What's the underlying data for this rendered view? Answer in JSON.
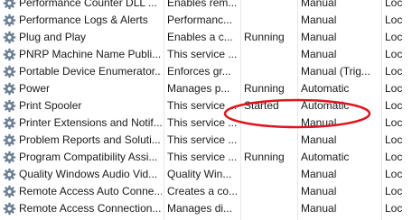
{
  "services": [
    {
      "name": "Performance Counter DLL ...",
      "description": "Enables rem...",
      "status": "",
      "startup_type": "Manual",
      "log_on_as": "Loc"
    },
    {
      "name": "Performance Logs & Alerts",
      "description": "Performanc...",
      "status": "",
      "startup_type": "Manual",
      "log_on_as": "Loc"
    },
    {
      "name": "Plug and Play",
      "description": "Enables a c...",
      "status": "Running",
      "startup_type": "Manual",
      "log_on_as": "Loc"
    },
    {
      "name": "PNRP Machine Name Publi...",
      "description": "This service ...",
      "status": "",
      "startup_type": "Manual",
      "log_on_as": "Loc"
    },
    {
      "name": "Portable Device Enumerator...",
      "description": "Enforces gr...",
      "status": "",
      "startup_type": "Manual (Trig...",
      "log_on_as": "Loc"
    },
    {
      "name": "Power",
      "description": "Manages p...",
      "status": "Running",
      "startup_type": "Automatic",
      "log_on_as": "Loc"
    },
    {
      "name": "Print Spooler",
      "description": "This service ...",
      "status": "Started",
      "startup_type": "Automatic",
      "log_on_as": "Loc"
    },
    {
      "name": "Printer Extensions and Notif...",
      "description": "This service ...",
      "status": "",
      "startup_type": "Manual",
      "log_on_as": "Loc"
    },
    {
      "name": "Problem Reports and Soluti...",
      "description": "This service ...",
      "status": "",
      "startup_type": "Manual",
      "log_on_as": "Loc"
    },
    {
      "name": "Program Compatibility Assi...",
      "description": "This service ...",
      "status": "Running",
      "startup_type": "Automatic",
      "log_on_as": "Loc"
    },
    {
      "name": "Quality Windows Audio Vid...",
      "description": "Quality Win...",
      "status": "",
      "startup_type": "Manual",
      "log_on_as": "Loc"
    },
    {
      "name": "Remote Access Auto Conne...",
      "description": "Creates a co...",
      "status": "",
      "startup_type": "Manual",
      "log_on_as": "Loc"
    },
    {
      "name": "Remote Access Connection...",
      "description": "Manages di...",
      "status": "",
      "startup_type": "Manual",
      "log_on_as": "Loc"
    }
  ],
  "row_icon": "gear-icon",
  "colors": {
    "annotation_ellipse": "#e0141e",
    "gear": "#6a7f95"
  }
}
